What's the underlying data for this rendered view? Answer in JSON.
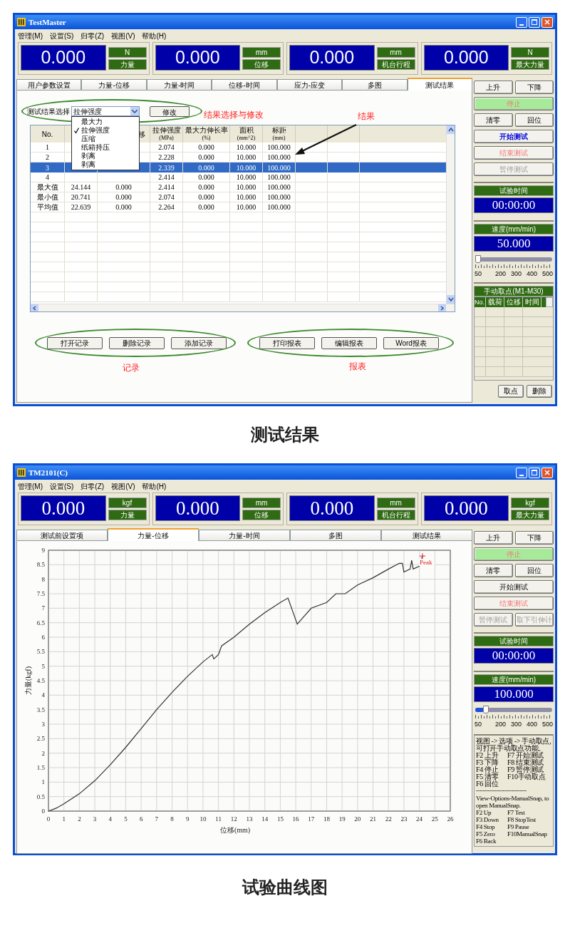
{
  "windows": [
    {
      "kind": "results",
      "title": "TestMaster",
      "caption": "测试结果",
      "menu": [
        "管理(M)",
        "设置(S)",
        "归零(Z)",
        "视图(V)",
        "帮助(H)"
      ],
      "readouts": [
        {
          "value": "0.000",
          "unit": "N",
          "name": "力量"
        },
        {
          "value": "0.000",
          "unit": "mm",
          "name": "位移"
        },
        {
          "value": "0.000",
          "unit": "mm",
          "name": "机台行程"
        },
        {
          "value": "0.000",
          "unit": "N",
          "name": "最大力量"
        }
      ],
      "tabs": [
        {
          "label": "用户参数设置",
          "selected": false
        },
        {
          "label": "力量-位移",
          "selected": false
        },
        {
          "label": "力量-时间",
          "selected": false
        },
        {
          "label": "位移-时间",
          "selected": false
        },
        {
          "label": "应力-应变",
          "selected": false
        },
        {
          "label": "多图",
          "selected": false
        },
        {
          "label": "测试结果",
          "selected": true
        }
      ],
      "results": {
        "select_label": "测试结果选择",
        "select_value": "拉伸强度",
        "modify_button": "修改",
        "dropdown": [
          {
            "label": "最大力",
            "selected": false
          },
          {
            "label": "拉伸强度",
            "selected": true
          },
          {
            "label": "压缩",
            "selected": false
          },
          {
            "label": "纸箱持压",
            "selected": false
          },
          {
            "label": "剥离",
            "selected": false
          },
          {
            "label": "剥离",
            "selected": false
          }
        ],
        "columns": [
          {
            "label": "No."
          },
          {},
          {
            "label": "移"
          },
          {
            "label": "拉伸强度",
            "unit": "(MPa)"
          },
          {
            "label": "最大力伸长率",
            "unit": "(%)"
          },
          {
            "label": "面积",
            "unit": "(mm^2)"
          },
          {
            "label": "标距",
            "unit": "(mm)"
          }
        ],
        "rows": [
          {
            "selected": false,
            "cells": [
              "1",
              null,
              null,
              "2.074",
              "0.000",
              "10.000",
              "100.000"
            ]
          },
          {
            "selected": false,
            "cells": [
              "2",
              null,
              null,
              "2.228",
              "0.000",
              "10.000",
              "100.000"
            ]
          },
          {
            "selected": true,
            "cells": [
              "3",
              null,
              null,
              "2.339",
              "0.000",
              "10.000",
              "100.000"
            ]
          },
          {
            "selected": false,
            "cells": [
              "4",
              null,
              null,
              "2.414",
              "0.000",
              "10.000",
              "100.000"
            ]
          },
          {
            "selected": false,
            "cells": [
              "最大值",
              "24.144",
              "0.000",
              "2.414",
              "0.000",
              "10.000",
              "100.000"
            ]
          },
          {
            "selected": false,
            "cells": [
              "最小值",
              "20.741",
              "0.000",
              "2.074",
              "0.000",
              "10.000",
              "100.000"
            ]
          },
          {
            "selected": false,
            "cells": [
              "平均值",
              "22.639",
              "0.000",
              "2.264",
              "0.000",
              "10.000",
              "100.000"
            ]
          }
        ],
        "record_buttons": [
          "打开记录",
          "删除记录",
          "添加记录"
        ],
        "report_buttons": [
          "打印报表",
          "编辑报表",
          "Word报表"
        ],
        "select_note": "结果选择与修改",
        "result_note": "结果",
        "records_note": "记录",
        "reports_note": "报表"
      },
      "side": {
        "button_rows": [
          [
            {
              "label": "上升",
              "kind": "normal",
              "disabled": false
            },
            {
              "label": "下降",
              "kind": "normal",
              "disabled": false
            }
          ],
          [
            {
              "label": "停止",
              "kind": "stop",
              "disabled": true
            }
          ],
          [
            {
              "label": "清零",
              "kind": "normal",
              "disabled": false
            },
            {
              "label": "回位",
              "kind": "normal",
              "disabled": false
            }
          ],
          [
            {
              "label": "开始测试",
              "kind": "accent",
              "disabled": false
            }
          ],
          [
            {
              "label": "结束测试",
              "kind": "danger",
              "disabled": true
            }
          ],
          [
            {
              "label": "暂停测试",
              "kind": "normal",
              "disabled": true
            }
          ]
        ],
        "timer": {
          "label": "试验时间",
          "value": "00:00:00"
        },
        "speed": {
          "label": "速度(mm/min)",
          "value": "50.000",
          "level": 0.0,
          "ticks": [
            "50",
            "200",
            "300",
            "400",
            "500"
          ]
        },
        "manual": {
          "title": "手动取点(M1-M30)",
          "columns": [
            "No.",
            "载荷",
            "位移",
            "时间"
          ],
          "buttons": [
            "取点",
            "删除"
          ]
        }
      }
    },
    {
      "kind": "curve",
      "title": "TM2101(C)",
      "caption": "试验曲线图",
      "menu": [
        "管理(M)",
        "设置(S)",
        "归零(Z)",
        "视图(V)",
        "帮助(H)"
      ],
      "readouts": [
        {
          "value": "0.000",
          "unit": "kgf",
          "name": "力量"
        },
        {
          "value": "0.000",
          "unit": "mm",
          "name": "位移"
        },
        {
          "value": "0.000",
          "unit": "mm",
          "name": "机台行程"
        },
        {
          "value": "0.000",
          "unit": "kgf",
          "name": "最大力量"
        }
      ],
      "tabs": [
        {
          "label": "测试前设置项",
          "selected": false
        },
        {
          "label": "力量-位移",
          "selected": true
        },
        {
          "label": "力量-时间",
          "selected": false
        },
        {
          "label": "多图",
          "selected": false
        },
        {
          "label": "测试结果",
          "selected": false
        }
      ],
      "chart_data": {
        "type": "line",
        "grid": true,
        "xlabel": "位移(mm)",
        "ylabel": "力量(kgf)",
        "xlim": [
          0,
          26
        ],
        "ylim": [
          0,
          9
        ],
        "xticks": [
          0,
          1,
          2,
          3,
          4,
          5,
          6,
          7,
          8,
          9,
          10,
          11,
          12,
          13,
          14,
          15,
          16,
          17,
          18,
          19,
          20,
          21,
          22,
          23,
          24,
          25,
          26
        ],
        "yticks": [
          0,
          0.5,
          1,
          1.5,
          2,
          2.5,
          3,
          3.5,
          4,
          4.5,
          5,
          5.5,
          6,
          6.5,
          7,
          7.5,
          8,
          8.5,
          9
        ],
        "x": [
          0,
          0.5,
          1,
          2,
          3,
          4,
          5,
          6,
          7,
          8,
          9,
          10,
          10.6,
          10.7,
          11,
          11.2,
          12,
          13,
          14,
          15,
          15.5,
          16.1,
          17,
          18,
          18.6,
          19.2,
          20,
          21,
          22,
          22.7,
          22.9,
          23,
          23.4,
          23.5,
          23.6,
          24,
          24.2
        ],
        "series": [
          {
            "color": "#333333",
            "values": [
              0,
              0.1,
              0.25,
              0.6,
              1.05,
              1.6,
              2.2,
              2.85,
              3.5,
              4.1,
              4.65,
              5.15,
              5.4,
              5.25,
              5.4,
              5.7,
              6.0,
              6.45,
              6.85,
              7.2,
              7.35,
              6.45,
              7.0,
              7.2,
              7.5,
              7.5,
              7.8,
              8.05,
              8.35,
              8.55,
              8.55,
              8.25,
              8.35,
              8.65,
              8.35,
              8.45,
              8.8
            ]
          }
        ],
        "annotations": [
          {
            "x": 24.2,
            "y": 8.8,
            "text": "Peak"
          }
        ]
      },
      "side": {
        "button_rows": [
          [
            {
              "label": "上升",
              "kind": "normal",
              "disabled": false
            },
            {
              "label": "下降",
              "kind": "normal",
              "disabled": false
            }
          ],
          [
            {
              "label": "停止",
              "kind": "stop",
              "disabled": true
            }
          ],
          [
            {
              "label": "清零",
              "kind": "normal",
              "disabled": false
            },
            {
              "label": "回位",
              "kind": "normal",
              "disabled": false
            }
          ],
          [
            {
              "label": "开始测试",
              "kind": "normal",
              "disabled": false
            }
          ],
          [
            {
              "label": "结束测试",
              "kind": "danger",
              "disabled": true
            }
          ],
          [
            {
              "label": "暂停测试",
              "kind": "normal",
              "disabled": true
            },
            {
              "label": "取下引伸计",
              "kind": "normal",
              "disabled": true
            }
          ]
        ],
        "timer": {
          "label": "试验时间",
          "value": "00:00:00"
        },
        "speed": {
          "label": "速度(mm/min)",
          "value": "100.000",
          "level": 0.11,
          "ticks": [
            "50",
            "200",
            "300",
            "400",
            "500"
          ]
        },
        "help": {
          "intro_cn": "视图 -> 选项 -> 手动取点,可打开手动取点功能。",
          "keys_cn": [
            {
              "left": "F2 上升",
              "right": "F7 开始测试"
            },
            {
              "left": "F3 下降",
              "right": "F8 结束测试"
            },
            {
              "left": "F4 停止",
              "right": "F9 暂停测试"
            },
            {
              "left": "F5 清零",
              "right": "F10手动取点"
            },
            {
              "left": "F6 回位"
            }
          ],
          "divider": "------------------------------",
          "intro_en": "View-Options-ManualSnap, to open ManualSnap.",
          "keys_en": [
            {
              "left": "F2 Up",
              "right": "F7 Test"
            },
            {
              "left": "F3 Down",
              "right": "F8 StopTest"
            },
            {
              "left": "F4 Stop",
              "right": "F9 Pause"
            },
            {
              "left": "F5 Zero",
              "right": "F10ManualSnap"
            },
            {
              "left": "F6 Back"
            }
          ]
        }
      }
    }
  ]
}
